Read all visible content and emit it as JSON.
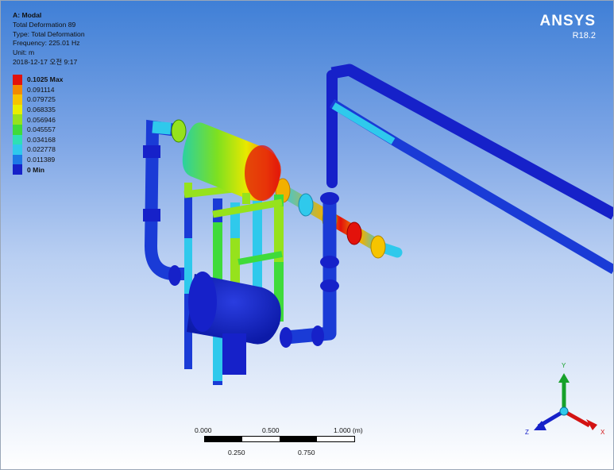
{
  "analysis": {
    "title": "A: Modal",
    "lines": [
      "Total Deformation 89",
      "Type: Total Deformation",
      "Frequency: 225.01 Hz",
      "Unit: m",
      "2018-12-17 오전 9:17"
    ]
  },
  "brand": {
    "name": "ANSYS",
    "version": "R18.2"
  },
  "legend": [
    {
      "label": "0.1025 Max",
      "color": "#e3120b",
      "bold": true
    },
    {
      "label": "0.091114",
      "color": "#f28a00"
    },
    {
      "label": "0.079725",
      "color": "#f6c400"
    },
    {
      "label": "0.068335",
      "color": "#e8ee00"
    },
    {
      "label": "0.056946",
      "color": "#96e21c"
    },
    {
      "label": "0.045557",
      "color": "#3fdb3a"
    },
    {
      "label": "0.034168",
      "color": "#2ee0b4"
    },
    {
      "label": "0.022778",
      "color": "#2fc9ec"
    },
    {
      "label": "0.011389",
      "color": "#1d78e6"
    },
    {
      "label": "0 Min",
      "color": "#1621c9",
      "bold": true
    }
  ],
  "scale_bar": {
    "top_labels": [
      "0.000",
      "0.500",
      "1.000 (m)"
    ],
    "bottom_labels": [
      "0.250",
      "0.750"
    ]
  },
  "triad": {
    "x": "X",
    "y": "Y",
    "z": "Z"
  }
}
